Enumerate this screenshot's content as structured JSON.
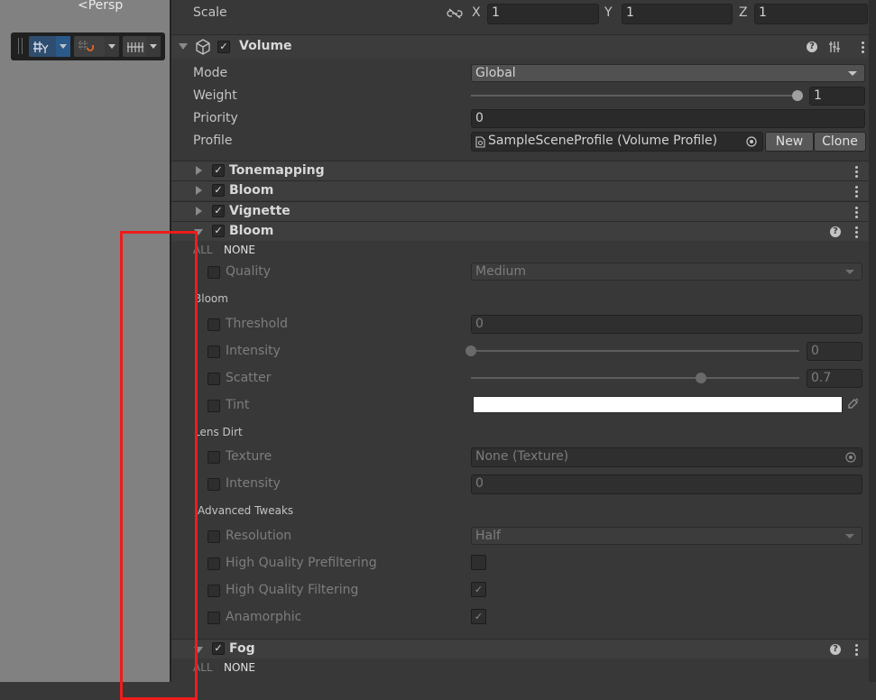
{
  "scene_view": {
    "persp_label": "<Persp"
  },
  "transform": {
    "scale_label": "Scale",
    "x_label": "X",
    "x_value": "1",
    "y_label": "Y",
    "y_value": "1",
    "z_label": "Z",
    "z_value": "1"
  },
  "volume": {
    "title": "Volume",
    "mode_label": "Mode",
    "mode_value": "Global",
    "weight_label": "Weight",
    "weight_value": "1",
    "weight_fraction": 1.0,
    "priority_label": "Priority",
    "priority_value": "0",
    "profile_label": "Profile",
    "profile_value": "SampleSceneProfile (Volume Profile)",
    "new_label": "New",
    "clone_label": "Clone"
  },
  "overrides": [
    {
      "name": "Tonemapping",
      "expanded": false
    },
    {
      "name": "Bloom",
      "expanded": false
    },
    {
      "name": "Vignette",
      "expanded": false
    },
    {
      "name": "Bloom",
      "expanded": true
    },
    {
      "name": "Fog",
      "expanded": true
    }
  ],
  "bloom_panel": {
    "all_label": "ALL",
    "none_label": "NONE",
    "quality_label": "Quality",
    "quality_value": "Medium",
    "bloom_section": "Bloom",
    "threshold_label": "Threshold",
    "threshold_value": "0",
    "intensity_label": "Intensity",
    "intensity_value": "0",
    "intensity_fraction": 0.0,
    "scatter_label": "Scatter",
    "scatter_value": "0.7",
    "scatter_fraction": 0.7,
    "tint_label": "Tint",
    "tint_color": "#ffffff",
    "lens_dirt_section": "Lens Dirt",
    "texture_label": "Texture",
    "texture_value": "None (Texture)",
    "dirt_intensity_label": "Intensity",
    "dirt_intensity_value": "0",
    "advanced_section": "Advanced Tweaks",
    "resolution_label": "Resolution",
    "resolution_value": "Half",
    "hq_prefiltering_label": "High Quality Prefiltering",
    "hq_prefiltering": false,
    "hq_filtering_label": "High Quality Filtering",
    "hq_filtering": true,
    "anamorphic_label": "Anamorphic",
    "anamorphic": true
  },
  "fog_panel": {
    "all_label": "ALL",
    "none_label": "NONE"
  },
  "colors": {
    "highlight_box": "#ee1c1c",
    "inspector_bg": "#383838",
    "scene_bg": "#818181"
  }
}
